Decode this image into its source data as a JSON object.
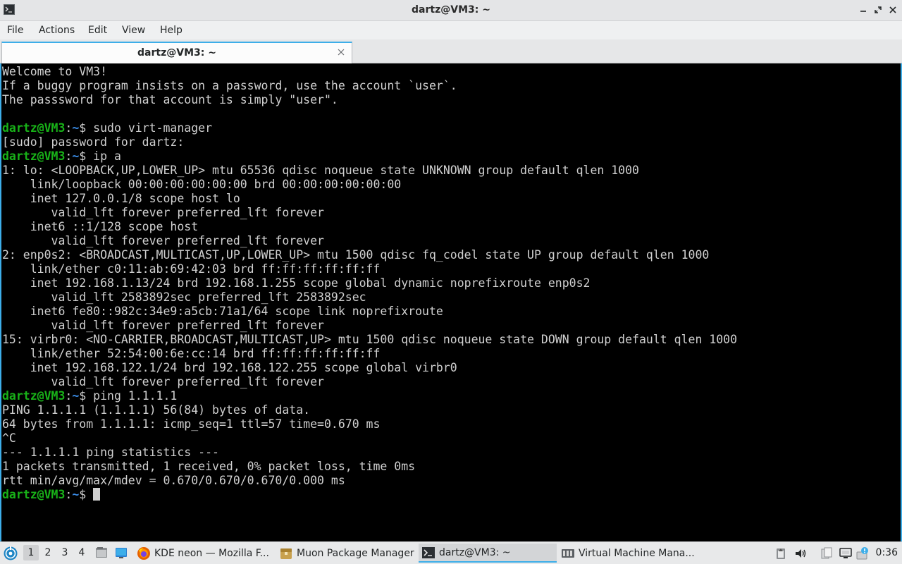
{
  "window": {
    "title": "dartz@VM3: ~"
  },
  "menubar": {
    "items": [
      "File",
      "Actions",
      "Edit",
      "View",
      "Help"
    ]
  },
  "tabs": [
    {
      "label": "dartz@VM3: ~",
      "active": true
    }
  ],
  "terminal": {
    "prompt": {
      "user_host": "dartz@VM3",
      "sep": ":",
      "path": "~",
      "symbol": "$ "
    },
    "lines": [
      {
        "type": "text",
        "text": "Welcome to VM3!"
      },
      {
        "type": "text",
        "text": "If a buggy program insists on a password, use the account `user`."
      },
      {
        "type": "text",
        "text": "The passsword for that account is simply \"user\"."
      },
      {
        "type": "text",
        "text": ""
      },
      {
        "type": "prompt",
        "command": "sudo virt-manager"
      },
      {
        "type": "text",
        "text": "[sudo] password for dartz:"
      },
      {
        "type": "prompt",
        "command": "ip a"
      },
      {
        "type": "text",
        "text": "1: lo: <LOOPBACK,UP,LOWER_UP> mtu 65536 qdisc noqueue state UNKNOWN group default qlen 1000"
      },
      {
        "type": "text",
        "text": "    link/loopback 00:00:00:00:00:00 brd 00:00:00:00:00:00"
      },
      {
        "type": "text",
        "text": "    inet 127.0.0.1/8 scope host lo"
      },
      {
        "type": "text",
        "text": "       valid_lft forever preferred_lft forever"
      },
      {
        "type": "text",
        "text": "    inet6 ::1/128 scope host"
      },
      {
        "type": "text",
        "text": "       valid_lft forever preferred_lft forever"
      },
      {
        "type": "text",
        "text": "2: enp0s2: <BROADCAST,MULTICAST,UP,LOWER_UP> mtu 1500 qdisc fq_codel state UP group default qlen 1000"
      },
      {
        "type": "text",
        "text": "    link/ether c0:11:ab:69:42:03 brd ff:ff:ff:ff:ff:ff"
      },
      {
        "type": "text",
        "text": "    inet 192.168.1.13/24 brd 192.168.1.255 scope global dynamic noprefixroute enp0s2"
      },
      {
        "type": "text",
        "text": "       valid_lft 2583892sec preferred_lft 2583892sec"
      },
      {
        "type": "text",
        "text": "    inet6 fe80::982c:34e9:a5cb:71a1/64 scope link noprefixroute"
      },
      {
        "type": "text",
        "text": "       valid_lft forever preferred_lft forever"
      },
      {
        "type": "text",
        "text": "15: virbr0: <NO-CARRIER,BROADCAST,MULTICAST,UP> mtu 1500 qdisc noqueue state DOWN group default qlen 1000"
      },
      {
        "type": "text",
        "text": "    link/ether 52:54:00:6e:cc:14 brd ff:ff:ff:ff:ff:ff"
      },
      {
        "type": "text",
        "text": "    inet 192.168.122.1/24 brd 192.168.122.255 scope global virbr0"
      },
      {
        "type": "text",
        "text": "       valid_lft forever preferred_lft forever"
      },
      {
        "type": "prompt",
        "command": "ping 1.1.1.1"
      },
      {
        "type": "text",
        "text": "PING 1.1.1.1 (1.1.1.1) 56(84) bytes of data."
      },
      {
        "type": "text",
        "text": "64 bytes from 1.1.1.1: icmp_seq=1 ttl=57 time=0.670 ms"
      },
      {
        "type": "text",
        "text": "^C"
      },
      {
        "type": "text",
        "text": "--- 1.1.1.1 ping statistics ---"
      },
      {
        "type": "text",
        "text": "1 packets transmitted, 1 received, 0% packet loss, time 0ms"
      },
      {
        "type": "text",
        "text": "rtt min/avg/max/mdev = 0.670/0.670/0.670/0.000 ms"
      },
      {
        "type": "prompt",
        "command": "",
        "cursor": true
      }
    ]
  },
  "taskbar": {
    "desktops": [
      "1",
      "2",
      "3",
      "4"
    ],
    "active_desktop": "1",
    "tasks": [
      {
        "label": "KDE neon — Mozilla F...",
        "icon": "firefox-icon"
      },
      {
        "label": "Muon Package Manager",
        "icon": "muon-package-manager-icon"
      },
      {
        "label": "dartz@VM3: ~",
        "icon": "terminal-icon",
        "active": true
      },
      {
        "label": "Virtual Machine Mana...",
        "icon": "virt-manager-icon"
      }
    ],
    "clock": "0:36"
  },
  "colors": {
    "accent": "#3daee9",
    "prompt_user": "#18b218",
    "prompt_path": "#3b8eea",
    "terminal_bg": "#000000",
    "terminal_fg": "#d0d0d0"
  }
}
